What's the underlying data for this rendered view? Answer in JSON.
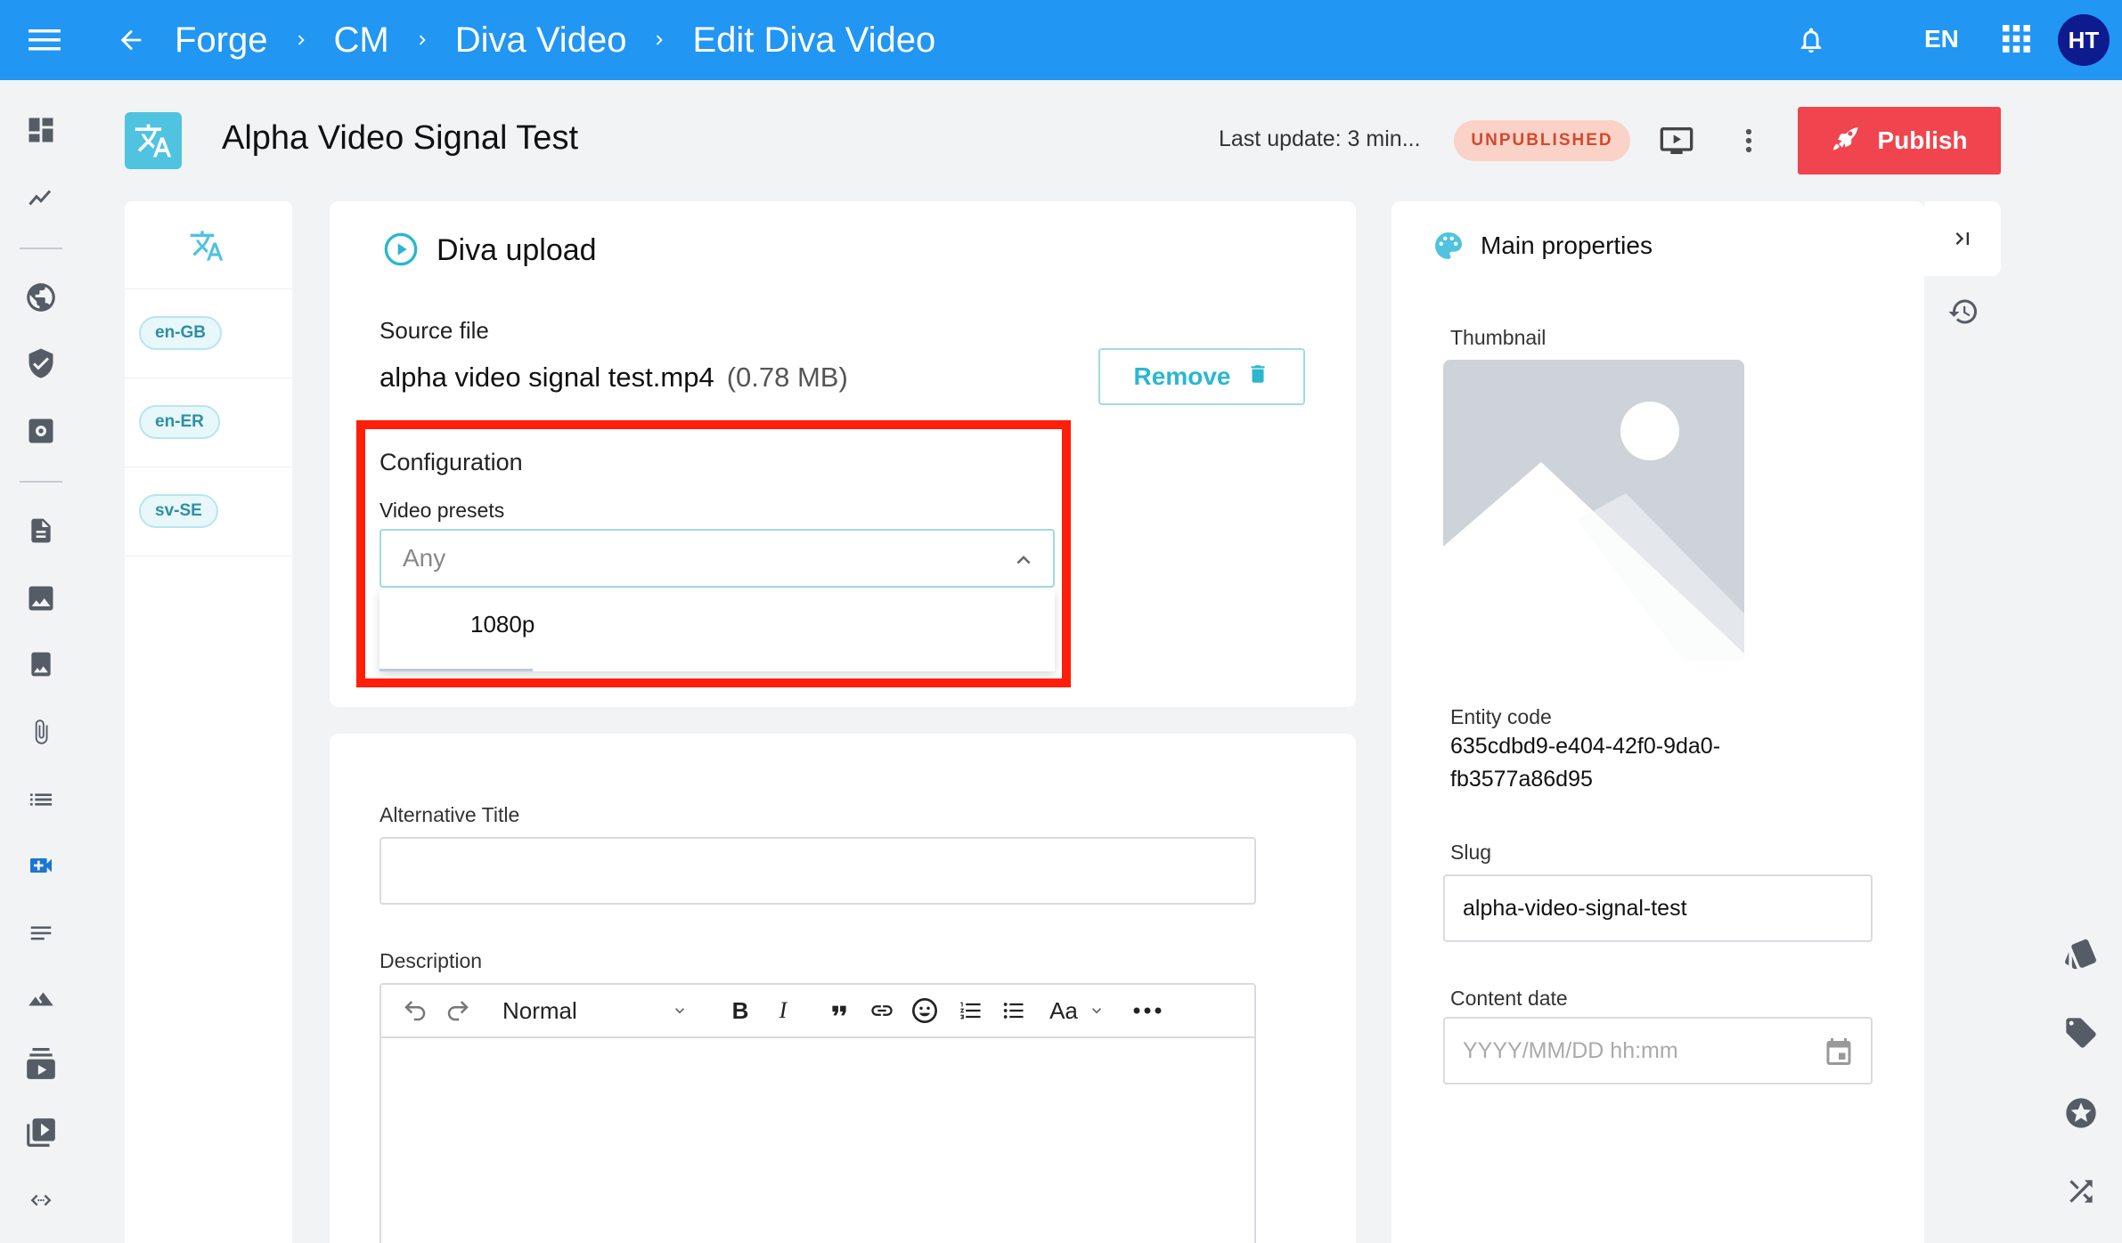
{
  "topbar": {
    "breadcrumbs": [
      "Forge",
      "CM",
      "Diva Video",
      "Edit Diva Video"
    ],
    "language": "EN",
    "avatar_initials": "HT",
    "color": "#2196f3"
  },
  "header": {
    "title": "Alpha Video Signal Test",
    "last_update": "Last update: 3 min...",
    "status": "UNPUBLISHED",
    "publish_label": "Publish"
  },
  "locales": [
    "en-GB",
    "en-ER",
    "sv-SE"
  ],
  "upload": {
    "title": "Diva upload",
    "source_label": "Source file",
    "file_name": "alpha video signal test.mp4",
    "file_size": "(0.78 MB)",
    "remove_label": "Remove",
    "config_label": "Configuration",
    "presets_label": "Video presets",
    "presets_value": "Any",
    "preset_options": [
      "1080p"
    ]
  },
  "form": {
    "alt_title_label": "Alternative Title",
    "description_label": "Description",
    "editor": {
      "block_style": "Normal",
      "font_label": "Aa"
    }
  },
  "properties": {
    "title": "Main properties",
    "thumbnail_label": "Thumbnail",
    "entity_code_label": "Entity code",
    "entity_code": "635cdbd9-e404-42f0-9da0-fb3577a86d95",
    "slug_label": "Slug",
    "slug_value": "alpha-video-signal-test",
    "content_date_label": "Content date",
    "content_date_placeholder": "YYYY/MM/DD hh:mm"
  },
  "colors": {
    "accent": "#2196f3",
    "publish": "#f0454e",
    "teal": "#4fc3e0",
    "highlight": "#ff1e0a"
  }
}
